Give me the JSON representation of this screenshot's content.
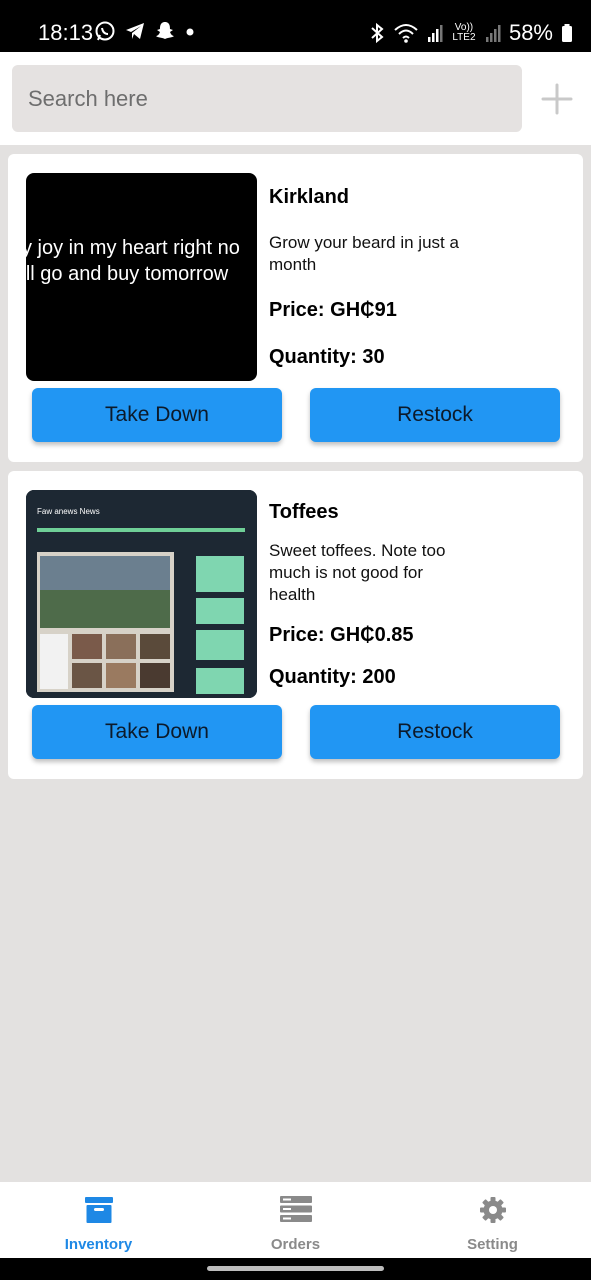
{
  "status_bar": {
    "time": "18:13",
    "battery": "58%",
    "network_label": "Vo)) LTE2"
  },
  "search": {
    "placeholder": "Search here"
  },
  "products": [
    {
      "name": "Kirkland",
      "description": "Grow your beard in just a month",
      "price": "Price: GH₵91",
      "quantity": "Quantity: 30",
      "image_text": [
        "y joy in my heart right no",
        "'ll go and buy tomorrow"
      ],
      "take_down_label": "Take Down",
      "restock_label": "Restock"
    },
    {
      "name": "Toffees",
      "description": "Sweet toffees. Note too much is not good for health",
      "price": "Price: GH₵0.85",
      "quantity": "Quantity: 200",
      "image_text": [
        "Faw anews News"
      ],
      "take_down_label": "Take Down",
      "restock_label": "Restock"
    }
  ],
  "bottom_nav": {
    "items": [
      {
        "label": "Inventory",
        "icon": "inventory-box-icon",
        "active": true
      },
      {
        "label": "Orders",
        "icon": "orders-list-icon",
        "active": false
      },
      {
        "label": "Setting",
        "icon": "gear-icon",
        "active": false
      }
    ]
  },
  "colors": {
    "accent": "#2196f3",
    "nav_active": "#1e88e5",
    "background": "#e3e1e0"
  }
}
